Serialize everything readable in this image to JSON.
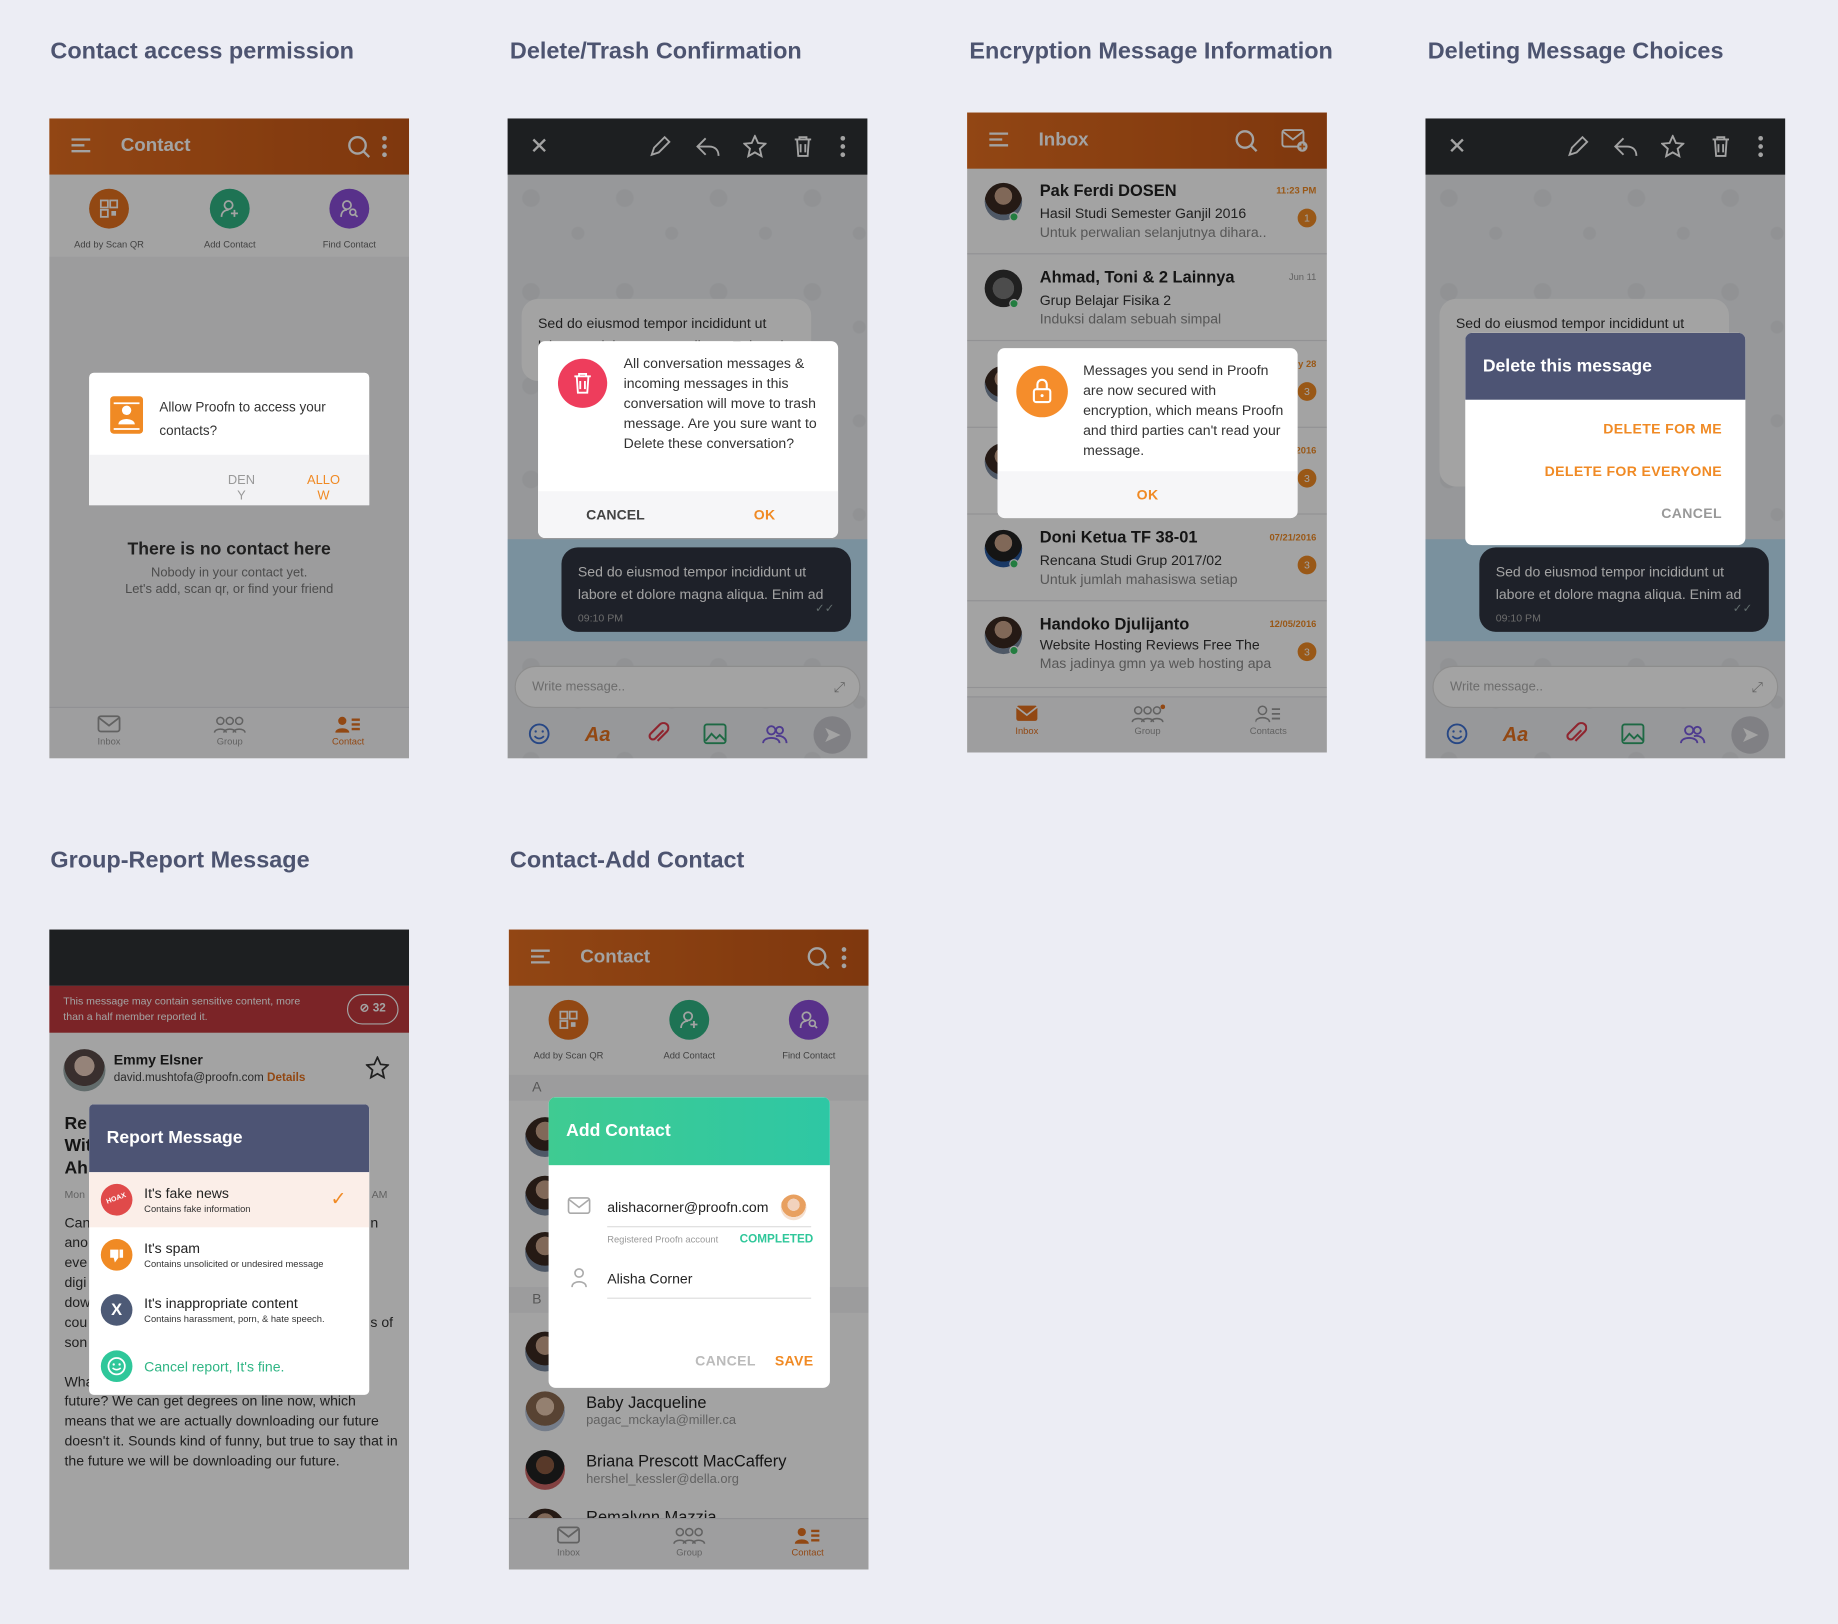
{
  "sections": {
    "s1": "Contact access permission",
    "s2": "Delete/Trash Confirmation",
    "s3": "Encryption Message Information",
    "s4": "Deleting Message Choices",
    "s5": "Group-Report Message",
    "s6": "Contact-Add Contact"
  },
  "contact": {
    "title": "Contact",
    "actions": [
      "Add by Scan QR",
      "Add Contact",
      "Find Contact"
    ],
    "empty_title": "There is no contact here",
    "empty_line1": "Nobody in your contact yet.",
    "empty_line2": "Let's add, scan qr, or find your friend",
    "permission_text": "Allow Proofn to access your contacts?",
    "deny": "DENY",
    "allow": "ALLOW"
  },
  "tabs": {
    "inbox": "Inbox",
    "group": "Group",
    "contact": "Contact",
    "contacts": "Contacts"
  },
  "chat": {
    "incoming": "Sed do eiusmod tempor incididunt ut labore et dolore magna aliqua. Enim ad",
    "outgoing": "Sed do eiusmod tempor incididunt ut labore et dolore magna aliqua. Enim ad",
    "time": "09:10 PM",
    "composer_placeholder": "Write message..",
    "format_label": "Aa"
  },
  "trash_dialog": {
    "text": "All conversation messages & incoming messages in this conversation will move to trash message. Are you sure want to Delete these conversation?",
    "cancel": "CANCEL",
    "ok": "OK"
  },
  "inbox": {
    "title": "Inbox",
    "rows": [
      {
        "name": "Pak Ferdi DOSEN",
        "subject": "Hasil Studi Semester Ganjil 2016",
        "preview": "Untuk perwalian selanjutnya dihara..",
        "time": "11:23 PM",
        "badge": "1"
      },
      {
        "name": "Ahmad, Toni & 2 Lainnya",
        "subject": "Grup Belajar Fisika 2",
        "preview": "Induksi dalam sebuah simpal",
        "time": "Jun 11",
        "badge": ""
      },
      {
        "name": "",
        "subject": "",
        "preview": "",
        "time": "y 28",
        "badge": "3"
      },
      {
        "name": "",
        "subject": "",
        "preview": "",
        "time": "2016",
        "badge": "3"
      },
      {
        "name": "Doni Ketua TF 38-01",
        "subject": "Rencana Studi Grup 2017/02",
        "preview": "Untuk jumlah mahasiswa setiap",
        "time": "07/21/2016",
        "badge": "3"
      },
      {
        "name": "Handoko Djulijanto",
        "subject": "Website Hosting Reviews Free The",
        "preview": "Mas jadinya gmn ya web hosting apa",
        "time": "12/05/2016",
        "badge": "3"
      }
    ],
    "encryption_text": "Messages you send in Proofn are now secured with encryption, which means Proofn and third parties can't read your message.",
    "ok": "OK"
  },
  "delete_choice": {
    "title": "Delete this message",
    "for_me": "DELETE FOR ME",
    "for_everyone": "DELETE FOR EVERYONE",
    "cancel": "CANCEL",
    "incoming_visible": "Sed do eiusmod tempor incididunt ut"
  },
  "report": {
    "warning": "This message may contain sensitive content, more than a half member reported it.",
    "count": "32",
    "sender_name": "Emmy Elsner",
    "sender_email": "david.mushtofa@proofn.com",
    "details": "Details",
    "title": "Report Message",
    "options": [
      {
        "title": "It's fake news",
        "sub": "Contains fake information",
        "icon": "HOAX"
      },
      {
        "title": "It's spam",
        "sub": "Contains unsolicited or undesired message"
      },
      {
        "title": "It's inappropriate content",
        "sub": "Contains harassment, porn, & hate speech."
      }
    ],
    "cancel_report": "Cancel report, It's fine.",
    "body_partial": [
      "Re",
      "Wit",
      "Ah"
    ],
    "meta_left": "Mon",
    "meta_right": "AM",
    "body_left": [
      "Can",
      "ano",
      "eve",
      "digi",
      "dow",
      "cou",
      "son",
      "",
      "Wha"
    ],
    "body_right": [
      "n",
      "",
      "",
      "",
      "",
      "s of"
    ],
    "body_tail": "future? We can get degrees on line now, which means that we are actually downloading our future doesn't it. Sounds kind of funny, but true to say that in the future we will be downloading our future."
  },
  "add_contact": {
    "title": "Add Contact",
    "email": "alishacorner@proofn.com",
    "registered": "Registered Proofn account",
    "completed": "COMPLETED",
    "name": "Alisha Corner",
    "cancel": "CANCEL",
    "save": "SAVE",
    "letter_a": "A",
    "letter_b": "B",
    "contacts": [
      {
        "name": "Baby Jacqueline",
        "email": "pagac_mckayla@miller.ca"
      },
      {
        "name": "Briana Prescott MacCaffery",
        "email": "hershel_kessler@della.org"
      },
      {
        "name": "Remalynn Mazzia",
        "email": ""
      }
    ]
  },
  "colors": {
    "orange": "#e4711e",
    "accent": "#f08a24",
    "dark": "#2e3135",
    "navy": "#4d5474",
    "green": "#2fc79a",
    "red": "#b8383b"
  }
}
